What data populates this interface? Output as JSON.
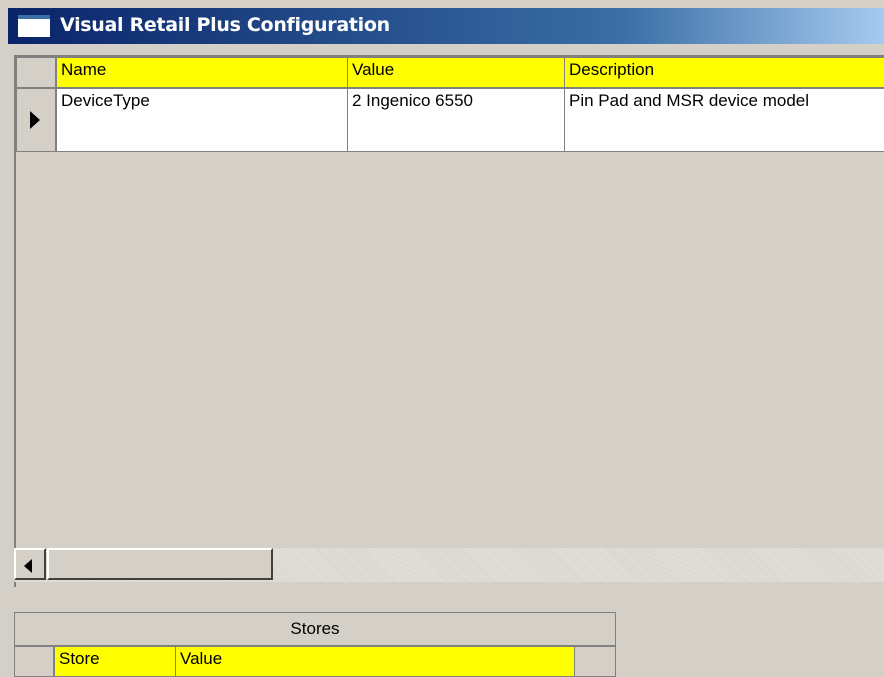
{
  "window": {
    "title": "Visual Retail Plus Configuration"
  },
  "config_grid": {
    "columns": [
      "Name",
      "Value",
      "Description"
    ],
    "rows": [
      {
        "name": "DeviceType",
        "value": "2 Ingenico 6550",
        "description": "Pin Pad and MSR device model"
      }
    ]
  },
  "stores_grid": {
    "caption": "Stores",
    "columns": [
      "Store",
      "Value"
    ]
  },
  "colors": {
    "header_bg": "#ffff00",
    "titlebar": "#0a246a",
    "face": "#d4d0c8"
  }
}
